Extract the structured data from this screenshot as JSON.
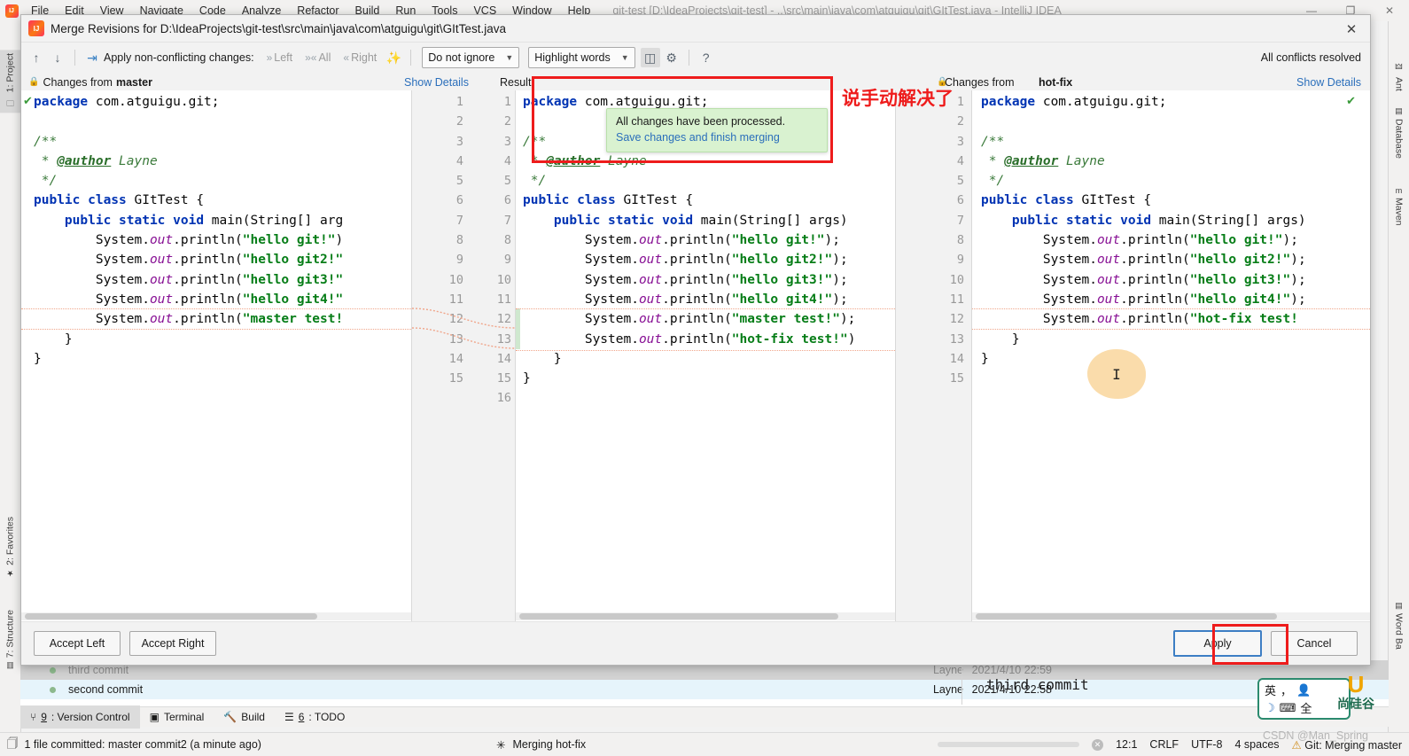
{
  "ide": {
    "menu": [
      "File",
      "Edit",
      "View",
      "Navigate",
      "Code",
      "Analyze",
      "Refactor",
      "Build",
      "Run",
      "Tools",
      "VCS",
      "Window",
      "Help"
    ],
    "window_title": "git-test [D:\\IdeaProjects\\git-test] - ..\\src\\main\\java\\com\\atguigu\\git\\GItTest.java - IntelliJ IDEA",
    "win_minimize": "—",
    "win_maximize": "❐",
    "win_close": "✕"
  },
  "rails": {
    "left": [
      {
        "label": "1: Project",
        "icon": "folder-icon"
      },
      {
        "label": "2: Favorites",
        "icon": "star-icon"
      },
      {
        "label": "7: Structure",
        "icon": "structure-icon"
      }
    ],
    "right": [
      {
        "label": "Ant",
        "icon": "ant-icon"
      },
      {
        "label": "Database",
        "icon": "database-icon"
      },
      {
        "label": "Maven",
        "icon": "maven-icon"
      },
      {
        "label": "Word Ba",
        "icon": "wordbank-icon"
      }
    ]
  },
  "dialog": {
    "title": "Merge Revisions for D:\\IdeaProjects\\git-test\\src\\main\\java\\com\\atguigu\\git\\GItTest.java",
    "close_glyph": "✕",
    "toolbar": {
      "prev_glyph": "↑",
      "next_glyph": "↓",
      "apply_label": "Apply non-conflicting changes:",
      "left_label": "Left",
      "all_label": "All",
      "right_label": "Right",
      "ignore_select": "Do not ignore",
      "highlight_select": "Highlight words",
      "help_glyph": "?",
      "conflicts_status": "All conflicts resolved"
    },
    "panels": {
      "left_header": "Changes from",
      "left_branch": "master",
      "left_showdetails": "Show Details",
      "result_header": "Result",
      "right_header": "Changes from",
      "right_branch": "hot-fix",
      "right_showdetails": "Show Details"
    },
    "balloon": {
      "line1": "All changes have been processed.",
      "line2": "Save changes and finish merging"
    },
    "annotation_text": "说手动解决了",
    "buttons": {
      "accept_left": "Accept Left",
      "accept_right": "Accept Right",
      "apply": "Apply",
      "cancel": "Cancel"
    }
  },
  "code": {
    "left_lines": [
      {
        "n": 1,
        "html": "<span class='kw'>package</span> <span class='pl'>com.atguigu.git;</span>"
      },
      {
        "n": 2,
        "html": ""
      },
      {
        "n": 3,
        "html": "<span class='cm'>/**</span>"
      },
      {
        "n": 4,
        "html": "<span class='cm'> * </span><span class='tag'>@author</span><span class='cm'> Layne</span>"
      },
      {
        "n": 5,
        "html": "<span class='cm'> */</span>"
      },
      {
        "n": 6,
        "html": "<span class='kw'>public class</span> <span class='pl'>GItTest {</span>"
      },
      {
        "n": 7,
        "html": "    <span class='kw'>public static void</span> <span class='pl'>main(String[] arg</span>"
      },
      {
        "n": 8,
        "html": "        <span class='pl'>System.</span><span class='fld'>out</span><span class='pl'>.println(</span><span class='st'>\"hello git!\"</span><span class='pl'>)</span>"
      },
      {
        "n": 9,
        "html": "        <span class='pl'>System.</span><span class='fld'>out</span><span class='pl'>.println(</span><span class='st'>\"hello git2!\"</span>"
      },
      {
        "n": 10,
        "html": "        <span class='pl'>System.</span><span class='fld'>out</span><span class='pl'>.println(</span><span class='st'>\"hello git3!\"</span>"
      },
      {
        "n": 11,
        "html": "        <span class='pl'>System.</span><span class='fld'>out</span><span class='pl'>.println(</span><span class='st'>\"hello git4!\"</span>"
      },
      {
        "n": 12,
        "html": "        <span class='pl'>System.</span><span class='fld'>out</span><span class='pl'>.println(</span><span class='st'>\"master test!</span>"
      },
      {
        "n": 13,
        "html": "    <span class='pl'>}</span>"
      },
      {
        "n": 14,
        "html": "<span class='pl'>}</span>"
      },
      {
        "n": 15,
        "html": ""
      }
    ],
    "result_lines": [
      {
        "n": 1,
        "html": "<span class='kw'>package</span> <span class='pl'>com.atguigu.git;</span>"
      },
      {
        "n": 2,
        "html": ""
      },
      {
        "n": 3,
        "html": "<span class='cm'>/**</span>"
      },
      {
        "n": 4,
        "html": "<span class='cm'> * </span><span class='tag'>@author</span><span class='cm'> Layne</span>"
      },
      {
        "n": 5,
        "html": "<span class='cm'> */</span>"
      },
      {
        "n": 6,
        "html": "<span class='kw'>public class</span> <span class='pl'>GItTest {</span>"
      },
      {
        "n": 7,
        "html": "    <span class='kw'>public static void</span> <span class='pl'>main(String[] args)</span>"
      },
      {
        "n": 8,
        "html": "        <span class='pl'>System.</span><span class='fld'>out</span><span class='pl'>.println(</span><span class='st'>\"hello git!\"</span><span class='pl'>);</span>"
      },
      {
        "n": 9,
        "html": "        <span class='pl'>System.</span><span class='fld'>out</span><span class='pl'>.println(</span><span class='st'>\"hello git2!\"</span><span class='pl'>);</span>"
      },
      {
        "n": 10,
        "html": "        <span class='pl'>System.</span><span class='fld'>out</span><span class='pl'>.println(</span><span class='st'>\"hello git3!\"</span><span class='pl'>);</span>"
      },
      {
        "n": 11,
        "html": "        <span class='pl'>System.</span><span class='fld'>out</span><span class='pl'>.println(</span><span class='st'>\"hello git4!\"</span><span class='pl'>);</span>"
      },
      {
        "n": 12,
        "html": "        <span class='pl'>System.</span><span class='fld'>out</span><span class='pl'>.println(</span><span class='st'>\"master test!\"</span><span class='pl'>);</span>"
      },
      {
        "n": 13,
        "html": "        <span class='pl'>System.</span><span class='fld'>out</span><span class='pl'>.println(</span><span class='st'>\"hot-fix test!\"</span><span class='pl'>)</span>"
      },
      {
        "n": 14,
        "html": "    <span class='pl'>}</span>"
      },
      {
        "n": 15,
        "html": "<span class='pl'>}</span>"
      },
      {
        "n": 16,
        "html": ""
      }
    ],
    "right_lines": [
      {
        "n": 1,
        "html": "<span class='kw'>package</span> <span class='pl'>com.atguigu.git;</span>"
      },
      {
        "n": 2,
        "html": ""
      },
      {
        "n": 3,
        "html": "<span class='cm'>/**</span>"
      },
      {
        "n": 4,
        "html": "<span class='cm'> * </span><span class='tag'>@author</span><span class='cm'> Layne</span>"
      },
      {
        "n": 5,
        "html": "<span class='cm'> */</span>"
      },
      {
        "n": 6,
        "html": "<span class='kw'>public class</span> <span class='pl'>GItTest {</span>"
      },
      {
        "n": 7,
        "html": "    <span class='kw'>public static void</span> <span class='pl'>main(String[] args)</span>"
      },
      {
        "n": 8,
        "html": "        <span class='pl'>System.</span><span class='fld'>out</span><span class='pl'>.println(</span><span class='st'>\"hello git!\"</span><span class='pl'>);</span>"
      },
      {
        "n": 9,
        "html": "        <span class='pl'>System.</span><span class='fld'>out</span><span class='pl'>.println(</span><span class='st'>\"hello git2!\"</span><span class='pl'>);</span>"
      },
      {
        "n": 10,
        "html": "        <span class='pl'>System.</span><span class='fld'>out</span><span class='pl'>.println(</span><span class='st'>\"hello git3!\"</span><span class='pl'>);</span>"
      },
      {
        "n": 11,
        "html": "        <span class='pl'>System.</span><span class='fld'>out</span><span class='pl'>.println(</span><span class='st'>\"hello git4!\"</span><span class='pl'>);</span>"
      },
      {
        "n": 12,
        "html": "        <span class='pl'>System.</span><span class='fld'>out</span><span class='pl'>.println(</span><span class='st'>\"hot-fix test!</span>"
      },
      {
        "n": 13,
        "html": "    <span class='pl'>}</span>"
      },
      {
        "n": 14,
        "html": "<span class='pl'>}</span>"
      },
      {
        "n": 15,
        "html": ""
      }
    ]
  },
  "vcs_log": {
    "rows": [
      {
        "message": "third commit",
        "author": "Layne",
        "date": "2021/4/10 22:59"
      },
      {
        "message": "second commit",
        "author": "Layne",
        "date": "2021/4/10 22:58"
      }
    ],
    "detail_message": "third commit"
  },
  "tool_tabs": [
    {
      "num": "9",
      "label": ": Version Control",
      "icon": "branch-icon",
      "selected": true
    },
    {
      "num": "",
      "label": "Terminal",
      "icon": "terminal-icon",
      "selected": false
    },
    {
      "num": "",
      "label": "Build",
      "icon": "hammer-icon",
      "selected": false
    },
    {
      "num": "6",
      "label": ": TODO",
      "icon": "list-icon",
      "selected": false
    }
  ],
  "status_bar": {
    "commit_status": "1 file committed: master commit2 (a minute ago)",
    "background_task": "Merging hot-fix",
    "caret_position": "12:1",
    "line_separator": "CRLF",
    "encoding": "UTF-8",
    "indent": "4 spaces",
    "git_status": "Git: Merging master"
  },
  "ime": {
    "lang": "英",
    "punct": "，",
    "moon": "☽",
    "keyboard": "⌨",
    "full": "全",
    "person": "👤"
  },
  "branding": {
    "logo_letter": "U",
    "name": "尚硅谷",
    "watermark": "CSDN @Man_Spring"
  },
  "colors": {
    "accent_link": "#2b6fbb",
    "annotation_red": "#ee1c1c",
    "balloon_bg": "#d9f2d0",
    "keyword": "#0033b3",
    "string": "#067d17",
    "comment": "#3a7a3a",
    "field": "#871094",
    "focus_border": "#3d7ec4"
  }
}
